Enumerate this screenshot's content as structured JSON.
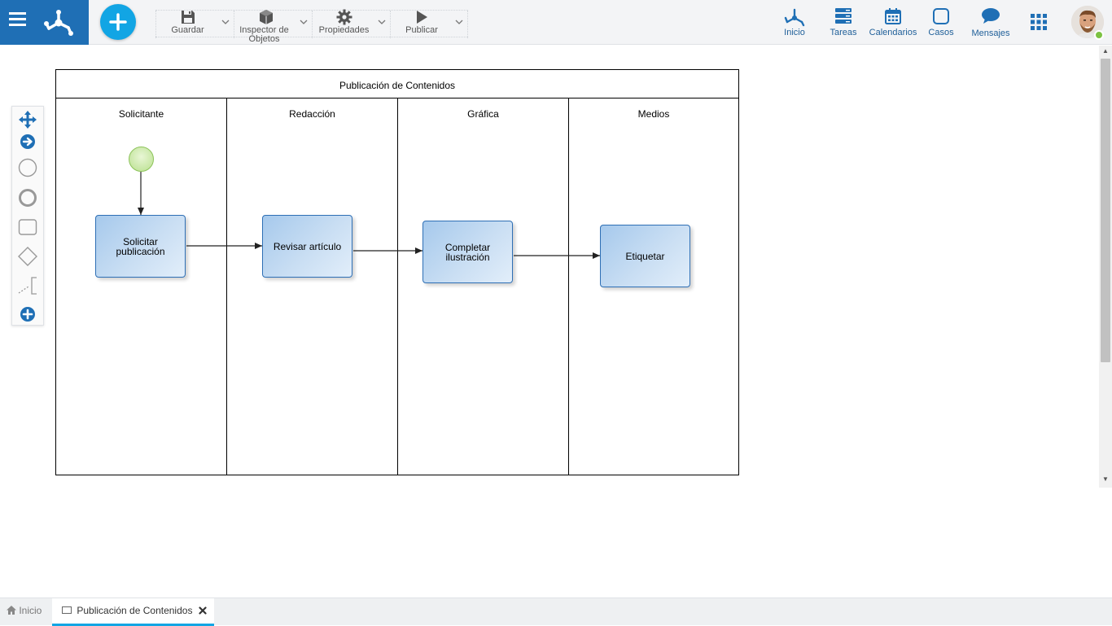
{
  "toolbar": {
    "save_label": "Guardar",
    "inspector_label": "Inspector de Objetos",
    "properties_label": "Propiedades",
    "publish_label": "Publicar"
  },
  "nav": {
    "home_label": "Inicio",
    "tasks_label": "Tareas",
    "calendars_label": "Calendarios",
    "cases_label": "Casos",
    "messages_label": "Mensajes"
  },
  "diagram": {
    "pool_title": "Publicación de Contenidos",
    "lanes": [
      "Solicitante",
      "Redacción",
      "Gráfica",
      "Medios"
    ],
    "tasks": [
      "Solicitar publicación",
      "Revisar artículo",
      "Completar ilustración",
      "Etiquetar"
    ]
  },
  "palette": {
    "tools": [
      "move-icon",
      "flow-arrow-icon",
      "start-event-icon",
      "end-event-icon",
      "task-icon",
      "gateway-icon",
      "annotation-icon",
      "more-icon"
    ]
  },
  "bottom_tabs": {
    "home_label": "Inicio",
    "doc_label": "Publicación de Contenidos"
  },
  "colors": {
    "brand": "#1f6fb5",
    "accent": "#12a5e4",
    "task_border": "#2e6fb5",
    "start_event": "#8cc35a",
    "online": "#7cc242"
  }
}
